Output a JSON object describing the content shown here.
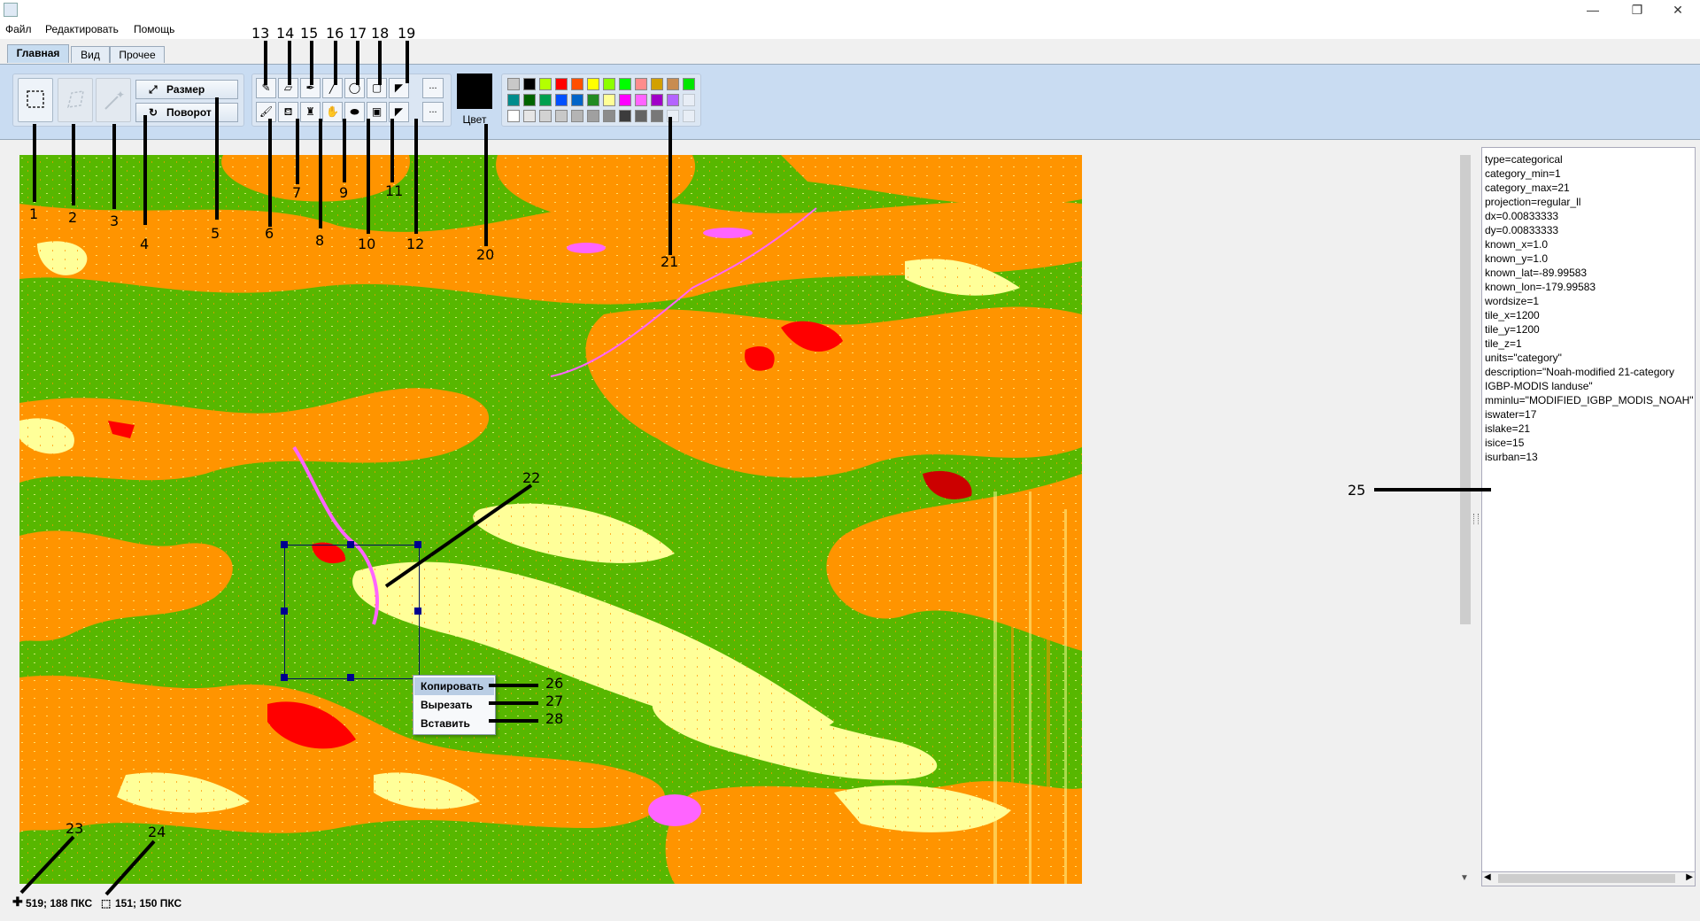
{
  "menu": {
    "file": "Файл",
    "edit": "Редактировать",
    "help": "Помощь"
  },
  "window_controls": {
    "minimize": "—",
    "restore": "❐",
    "close": "✕"
  },
  "tabs": [
    {
      "label": "Главная"
    },
    {
      "label": "Вид"
    },
    {
      "label": "Прочее"
    }
  ],
  "ribbon": {
    "resize_label": "Размер",
    "rotate_label": "Поворот",
    "more_label": "...",
    "color_label": "Цвет",
    "current_color": "#000000",
    "palette": [
      [
        "#c8c8c8",
        "#000000",
        "#b4ff00",
        "#ff0000",
        "#ff5000",
        "#ffff00",
        "#8cff00",
        "#00ff00",
        "#ff8c8c",
        "#d2a000",
        "#c88c50",
        "#00e600"
      ],
      [
        "#008c8c",
        "#006400",
        "#00a050",
        "#0050ff",
        "#0064c8",
        "#228b22",
        "#ffff96",
        "#ff00ff",
        "#ff64ff",
        "#a000c8",
        "#b464ff",
        ""
      ],
      [
        "#ffffff",
        "#e6e6e6",
        "#d2d2d2",
        "#c8c8c8",
        "#b4b4b4",
        "#a0a0a0",
        "#8c8c8c",
        "#3c3c3c",
        "#646464",
        "#787878",
        "",
        ""
      ]
    ]
  },
  "info_panel": {
    "lines": [
      "type=categorical",
      "category_min=1",
      "category_max=21",
      "projection=regular_ll",
      "dx=0.00833333",
      "dy=0.00833333",
      "known_x=1.0",
      "known_y=1.0",
      "known_lat=-89.99583",
      "known_lon=-179.99583",
      "wordsize=1",
      "tile_x=1200",
      "tile_y=1200",
      "tile_z=1",
      "units=\"category\"",
      "description=\"Noah-modified 21-category",
      "IGBP-MODIS landuse\"",
      "mminlu=\"MODIFIED_IGBP_MODIS_NOAH\"",
      "iswater=17",
      "islake=21",
      "isice=15",
      "isurban=13"
    ]
  },
  "context_menu": {
    "copy": "Копировать",
    "cut": "Вырезать",
    "paste": "Вставить"
  },
  "status": {
    "cursor_pos": "519; 188 ПКС",
    "selection_size": "151; 150 ПКС"
  },
  "callouts": [
    "1",
    "2",
    "3",
    "4",
    "5",
    "6",
    "7",
    "8",
    "9",
    "10",
    "11",
    "12",
    "13",
    "14",
    "15",
    "16",
    "17",
    "18",
    "19",
    "20",
    "21",
    "22",
    "23",
    "24",
    "25",
    "26",
    "27",
    "28"
  ]
}
